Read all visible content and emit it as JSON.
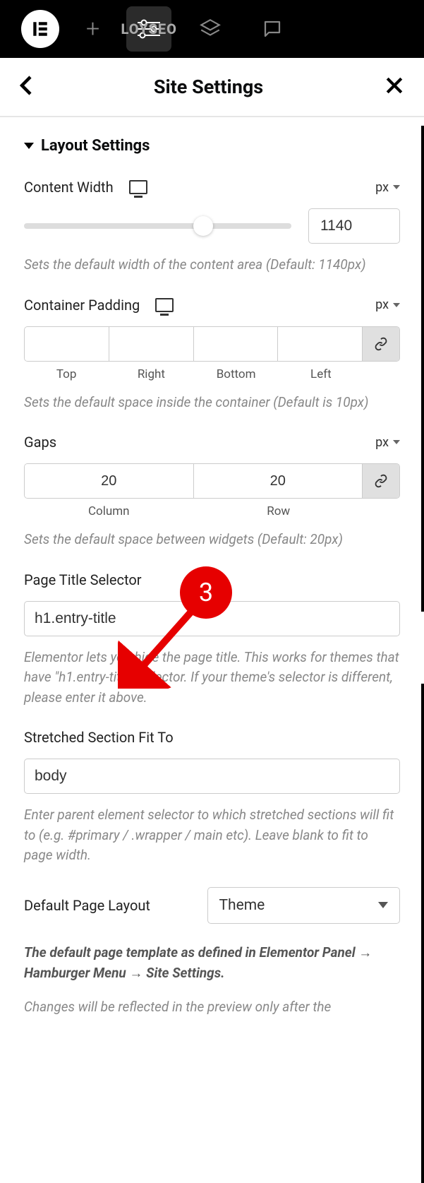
{
  "header": {
    "title": "Site Settings"
  },
  "section": {
    "title": "Layout Settings"
  },
  "content_width": {
    "label": "Content Width",
    "unit": "px",
    "value": "1140",
    "description": "Sets the default width of the content area (Default: 1140px)"
  },
  "container_padding": {
    "label": "Container Padding",
    "unit": "px",
    "sub": {
      "top": "Top",
      "right": "Right",
      "bottom": "Bottom",
      "left": "Left"
    },
    "description": "Sets the default space inside the container (Default is 10px)"
  },
  "gaps": {
    "label": "Gaps",
    "unit": "px",
    "column_value": "20",
    "row_value": "20",
    "sub": {
      "column": "Column",
      "row": "Row"
    },
    "description": "Sets the default space between widgets (Default: 20px)"
  },
  "page_title_selector": {
    "label": "Page Title Selector",
    "value": "h1.entry-title",
    "description": "Elementor lets you hide the page title. This works for themes that have \"h1.entry-title\" selector. If your theme's selector is different, please enter it above."
  },
  "stretched_section": {
    "label": "Stretched Section Fit To",
    "value": "body",
    "description": "Enter parent element selector to which stretched sections will fit to (e.g. #primary / .wrapper / main etc). Leave blank to fit to page width."
  },
  "default_page_layout": {
    "label": "Default Page Layout",
    "value": "Theme",
    "description_bold": "The default page template as defined in Elementor Panel → Hamburger Menu → Site Settings.",
    "description2": "Changes will be reflected in the preview only after the"
  },
  "annotation": {
    "number": "3"
  }
}
